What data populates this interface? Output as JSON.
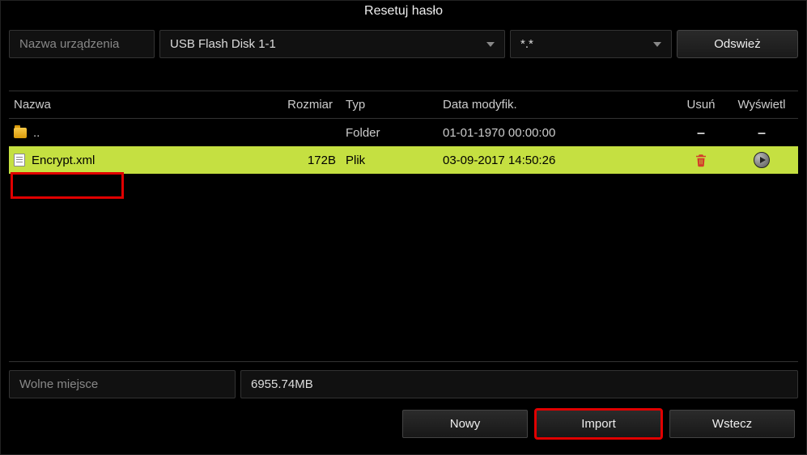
{
  "title": "Resetuj hasło",
  "toolbar": {
    "device_label": "Nazwa urządzenia",
    "device_value": "USB Flash Disk 1-1",
    "filter_value": "*.*",
    "refresh_label": "Odswież"
  },
  "columns": {
    "name": "Nazwa",
    "size": "Rozmiar",
    "type": "Typ",
    "date": "Data modyfik.",
    "delete": "Usuń",
    "view": "Wyświetl"
  },
  "rows": [
    {
      "kind": "parent",
      "name": "..",
      "size": "",
      "type": "Folder",
      "date": "01-01-1970 00:00:00",
      "del": "–",
      "view": "–"
    },
    {
      "kind": "file",
      "name": "Encrypt.xml",
      "size": "172B",
      "type": "Plik",
      "date": "03-09-2017 14:50:26"
    }
  ],
  "free": {
    "label": "Wolne miejsce",
    "value": "6955.74MB"
  },
  "buttons": {
    "new": "Nowy",
    "import": "Import",
    "back": "Wstecz"
  }
}
